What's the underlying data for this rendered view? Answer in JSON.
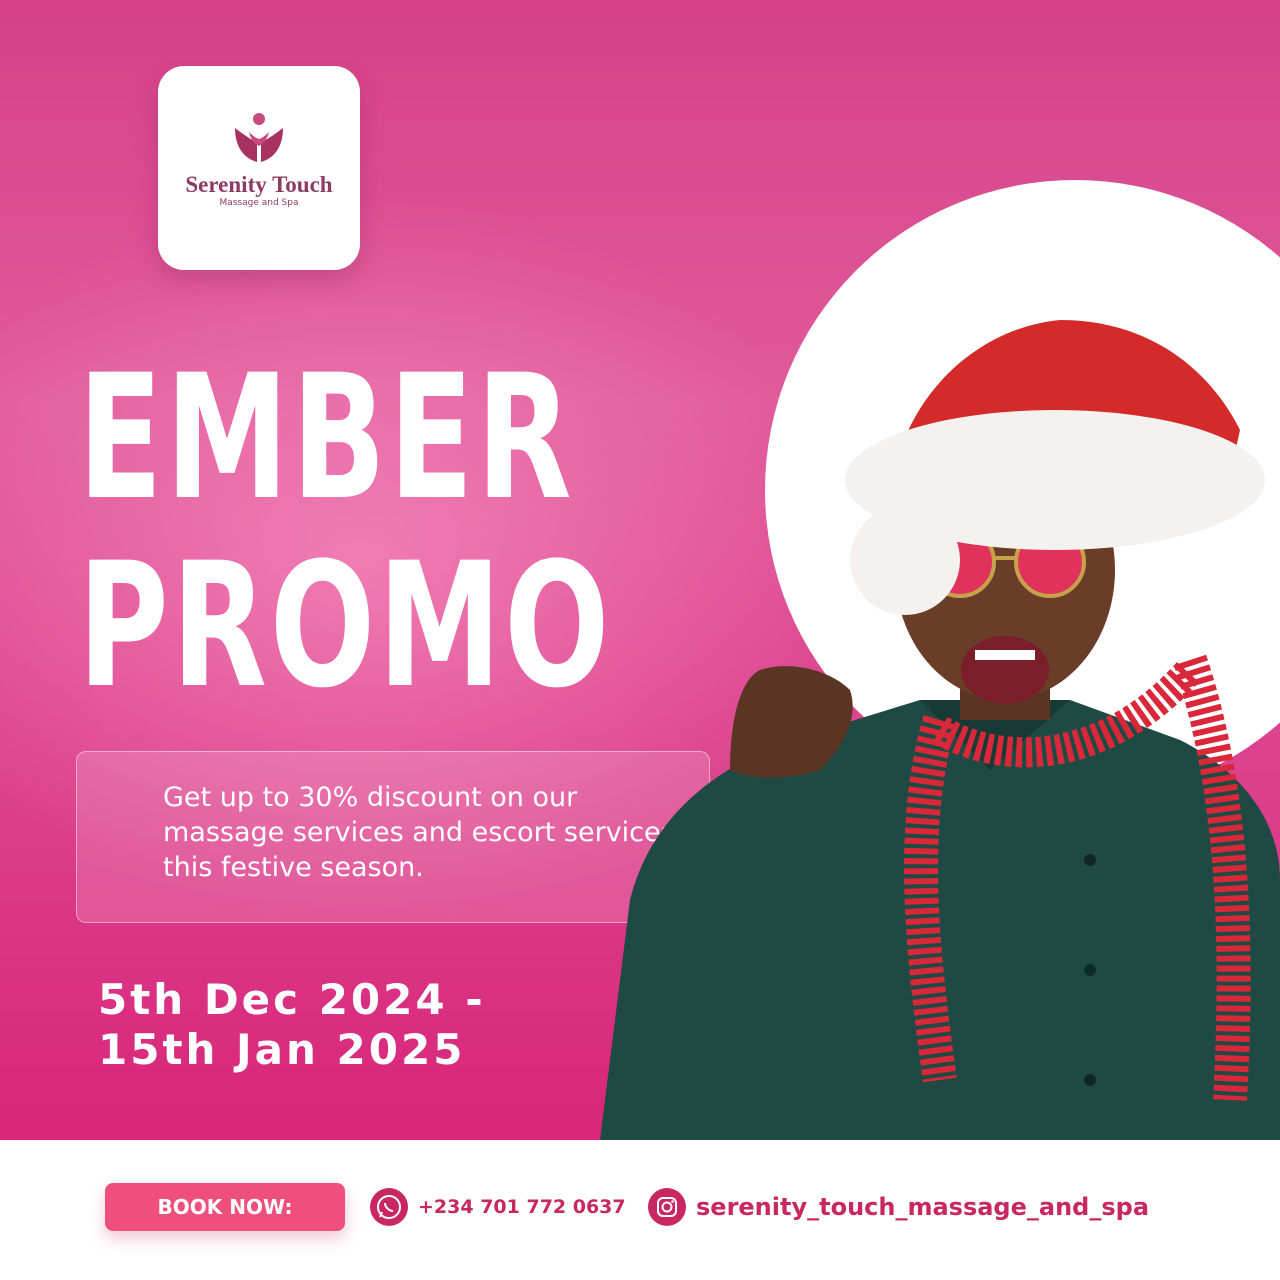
{
  "brand": {
    "name": "Serenity Touch",
    "tagline": "Massage and Spa"
  },
  "headline": {
    "line1": "EMBER",
    "line2": "PROMO"
  },
  "promo": {
    "description": "Get up to 30% discount on our massage services and escort services this festive season."
  },
  "dates": {
    "start": "5th Dec 2024 -",
    "end": "15th Jan 2025"
  },
  "footer": {
    "book_label": "BOOK NOW:",
    "phone": "+234 701 772 0637",
    "phone_icon": "whatsapp-icon",
    "instagram": "serenity_touch_massage_and_spa",
    "instagram_icon": "instagram-icon"
  },
  "colors": {
    "background_pink": "#dc3f8c",
    "accent": "#c8285f",
    "button": "#ee4f7c",
    "logo_text": "#8c3b63"
  }
}
